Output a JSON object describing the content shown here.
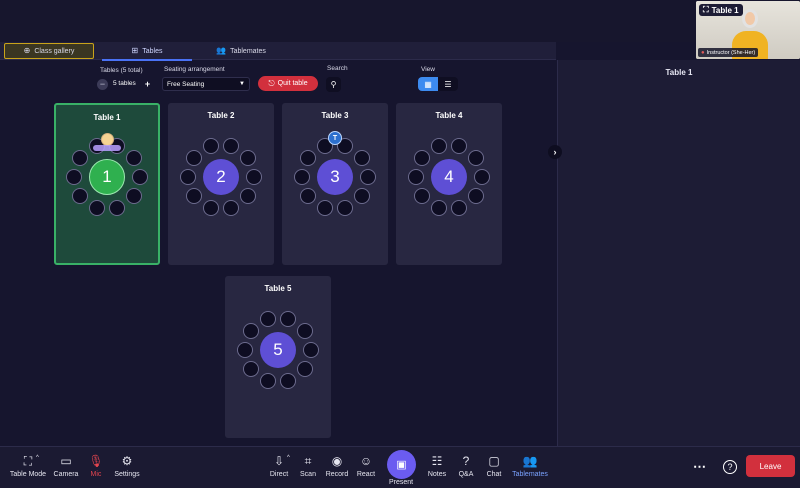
{
  "tabs": {
    "gallery": "Class gallery",
    "tables": "Tables",
    "tablemates": "Tablemates"
  },
  "controls": {
    "tables_label": "Tables (5 total)",
    "tables_value": "5 tables",
    "seating_label": "Seating arrangement",
    "seating_value": "Free Seating",
    "quit_label": "Quit table",
    "search_label": "Search",
    "view_label": "View"
  },
  "tables": [
    {
      "name": "Table 1",
      "number": "1",
      "active": true
    },
    {
      "name": "Table 2",
      "number": "2",
      "active": false
    },
    {
      "name": "Table 3",
      "number": "3",
      "active": false,
      "badge": "T"
    },
    {
      "name": "Table 4",
      "number": "4",
      "active": false
    },
    {
      "name": "Table 5",
      "number": "5",
      "active": false
    }
  ],
  "side_panel": {
    "title": "Table 1"
  },
  "video": {
    "table_label": "Table 1",
    "participant_label": "Instructor (She-Her)"
  },
  "toolbar": {
    "table_mode": "Table Mode",
    "camera": "Camera",
    "mic": "Mic",
    "settings": "Settings",
    "direct": "Direct",
    "scan": "Scan",
    "record": "Record",
    "react": "React",
    "present": "Present",
    "notes": "Notes",
    "qa": "Q&A",
    "chat": "Chat",
    "tablemates": "Tablemates",
    "leave": "Leave"
  },
  "colors": {
    "background": "#16152e",
    "accent_blue": "#3d8bf0",
    "active_table_green": "#2fb04f",
    "table_purple": "#5e4fd5",
    "danger_red": "#d2303d"
  }
}
